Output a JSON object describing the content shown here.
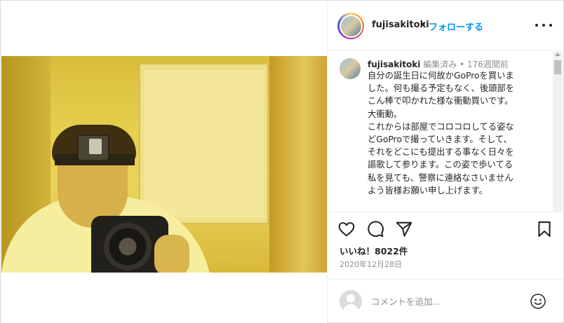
{
  "post": {
    "username": "fujisakitoki",
    "follow_label": "フォローする",
    "separator": "•"
  },
  "caption": {
    "username": "fujisakitoki",
    "edited_label": "編集済み",
    "time_sep": "•",
    "time_ago": "176週間前",
    "text": "自分の誕生日に何故かGoProを買いま\nした。何も撮る予定もなく、後頭部を\nこん棒で叩かれた様な衝動買いです。\n大衝動。\nこれからは部屋でコロコロしてる姿な\nどGoProで撮っていきます。そして、\nそれをどこにも提出する事なく日々を\n謳歌して参ります。この姿で歩いてる\n私を見ても、警察に連絡なさいません\nよう皆様お願い申し上げます。"
  },
  "engagement": {
    "likes_label": "いいね！8022件",
    "date": "2020年12月28日"
  },
  "comment_box": {
    "placeholder": "コメントを追加..."
  },
  "icons": [
    "more-options-icon",
    "heart-icon",
    "comment-icon",
    "share-icon",
    "bookmark-icon",
    "emoji-icon",
    "default-avatar-icon"
  ],
  "colors": {
    "link_blue": "#0095f6",
    "text": "#262626",
    "muted": "#8e8e8e",
    "border": "#dbdbdb"
  }
}
